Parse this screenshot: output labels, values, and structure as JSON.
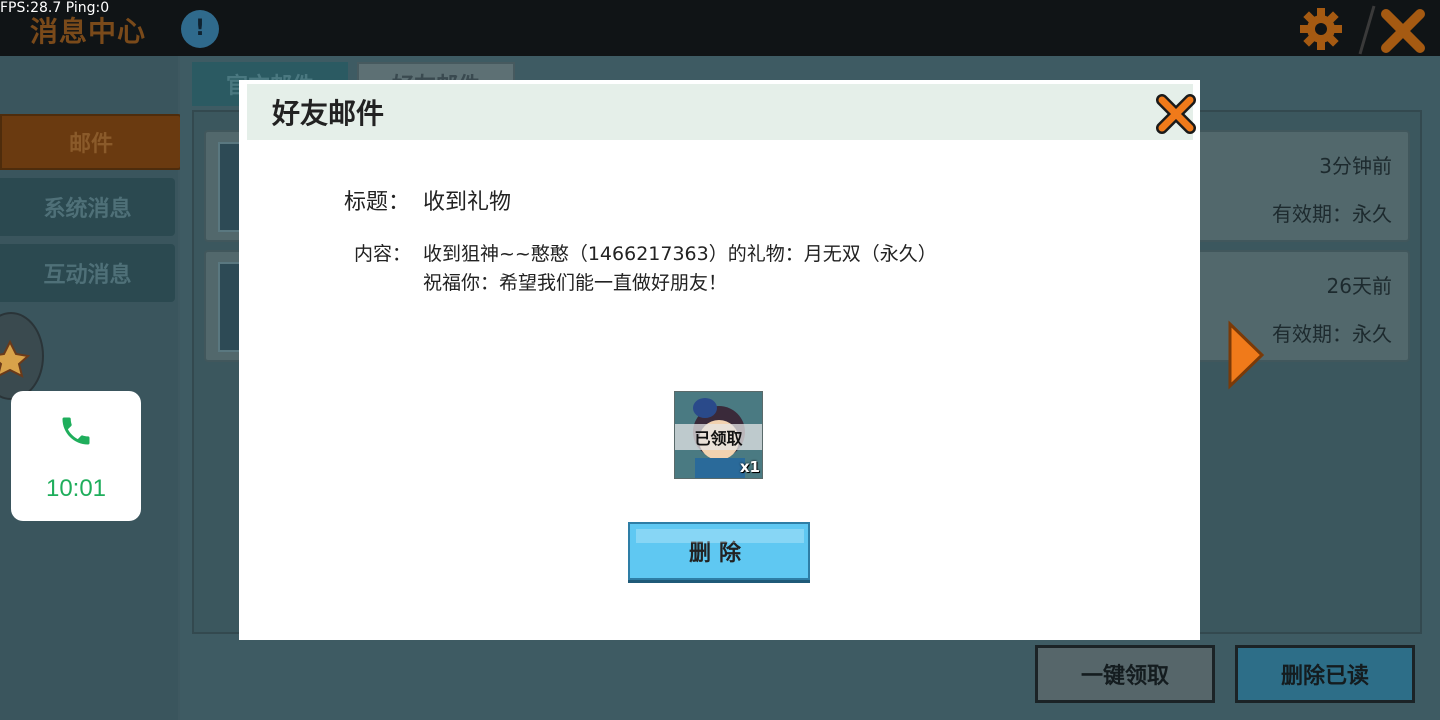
{
  "overlay": {
    "fps_text": "FPS:28.7  Ping:0"
  },
  "header": {
    "title": "消息中心"
  },
  "sidebar": {
    "items": [
      {
        "label": "邮件"
      },
      {
        "label": "系统消息"
      },
      {
        "label": "互动消息"
      }
    ]
  },
  "tabs": [
    {
      "label": "官方邮件"
    },
    {
      "label": "好友邮件"
    }
  ],
  "mail_list": [
    {
      "time": "3分钟前",
      "validity": "有效期：永久"
    },
    {
      "time": "26天前",
      "validity": "有效期：永久"
    }
  ],
  "bottom_buttons": {
    "claim_all": "一键领取",
    "delete_read": "删除已读"
  },
  "call_widget": {
    "time": "10:01"
  },
  "modal": {
    "title": "好友邮件",
    "subject_label": "标题：",
    "subject_value": "收到礼物",
    "content_label": "内容：",
    "content_line1": "收到狙神~~憨憨（1466217363）的礼物：月无双（永久）",
    "content_line2": "祝福你：希望我们能一直做好朋友！",
    "gift": {
      "status": "已领取",
      "quantity": "x1"
    },
    "delete_label": "删除"
  },
  "colors": {
    "accent_orange": "#f07a1a",
    "delete_button": "#5fc8f2",
    "call_green": "#1fae5c"
  }
}
